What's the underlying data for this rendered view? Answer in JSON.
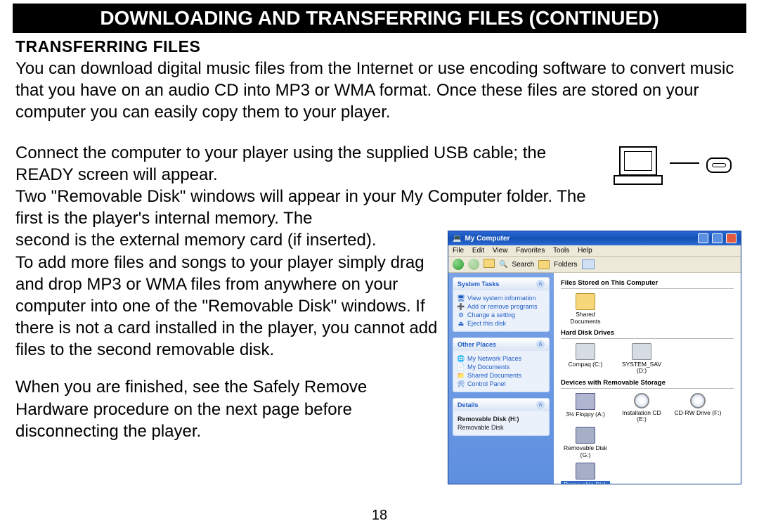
{
  "header": "DOWNLOADING AND TRANSFERRING FILES (CONTINUED)",
  "subheading": "TRANSFERRING FILES",
  "intro": "You can download digital music files from the Internet or use encoding software to convert music that you have on an audio CD into MP3 or WMA format. Once these files are stored on your computer you can easily copy them to your player.",
  "p2a": "Connect the computer to your player using the supplied USB cable; the READY screen will appear.",
  "p2b": "Two \"Removable Disk\" windows will appear in your My Computer folder. The first is the player's internal memory. The",
  "p2c": "second is the external memory card (if inserted).",
  "p3": "To add more files and songs to your player simply drag and drop MP3 or WMA files from anywhere on your computer into one of the \"Removable Disk\" windows. If there is not a card installed in the player, you cannot add files to the second removable disk.",
  "p4": "When you are finished, see the Safely Remove Hardware procedure on the next page before disconnecting the player.",
  "page_number": "18",
  "win": {
    "title": "My Computer",
    "menu": [
      "File",
      "Edit",
      "View",
      "Favorites",
      "Tools",
      "Help"
    ],
    "toolbar": {
      "search": "Search",
      "folders": "Folders"
    },
    "side": {
      "g1_head": "System Tasks",
      "g1_items": [
        "View system information",
        "Add or remove programs",
        "Change a setting",
        "Eject this disk"
      ],
      "g2_head": "Other Places",
      "g2_items": [
        "My Network Places",
        "My Documents",
        "Shared Documents",
        "Control Panel"
      ],
      "g3_head": "Details",
      "g3_items": [
        "Removable Disk (H:)",
        "Removable Disk"
      ]
    },
    "content": {
      "s1": "Files Stored on This Computer",
      "s1_items": [
        "Shared Documents"
      ],
      "s2": "Hard Disk Drives",
      "s2_items": [
        "Compaq (C:)",
        "SYSTEM_SAV (D:)"
      ],
      "s3": "Devices with Removable Storage",
      "s3_items": [
        "3½ Floppy (A:)",
        "Installation CD (E:)",
        "CD-RW Drive (F:)",
        "Removable Disk (G:)"
      ],
      "selected": "Removable Disk (H:)"
    }
  }
}
